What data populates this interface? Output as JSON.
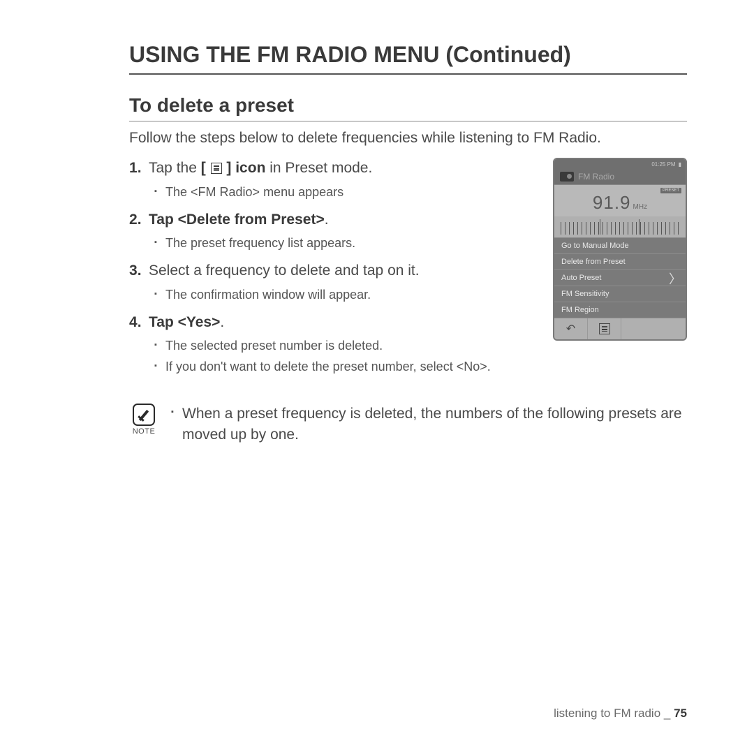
{
  "heading": "USING THE FM RADIO MENU (Continued)",
  "subheading": "To delete a preset",
  "intro": "Follow the steps below to delete frequencies while listening to FM Radio.",
  "steps": [
    {
      "prefix": "Tap the ",
      "has_icon": true,
      "bold_after_icon": " icon",
      "suffix": " in Preset mode.",
      "subs": [
        "The <FM Radio> menu appears"
      ]
    },
    {
      "prefix": "Tap ",
      "bold": "<Delete from Preset>",
      "suffix": ".",
      "all_bold_prefix": true,
      "subs": [
        "The preset frequency list appears."
      ]
    },
    {
      "prefix": "Select a frequency to delete and tap on it.",
      "subs": [
        "The confirmation window will appear."
      ]
    },
    {
      "prefix": "Tap ",
      "bold": "<Yes>",
      "suffix": ".",
      "all_bold_prefix": true,
      "subs": [
        "The selected preset number is deleted.",
        "If you don't want to delete the preset number, select <No>."
      ]
    }
  ],
  "device": {
    "status_time": "01:25 PM",
    "title": "FM Radio",
    "preset_badge": "PRESET",
    "frequency": "91.9",
    "unit": "MHz",
    "menu": [
      "Go to Manual Mode",
      "Delete from Preset",
      "Auto Preset",
      "FM Sensitivity",
      "FM Region"
    ]
  },
  "note_label": "NOTE",
  "note_text": "When a preset frequency is deleted, the numbers of the following presets are moved up by one.",
  "footer_text": "listening to FM radio _",
  "page_number": "75"
}
